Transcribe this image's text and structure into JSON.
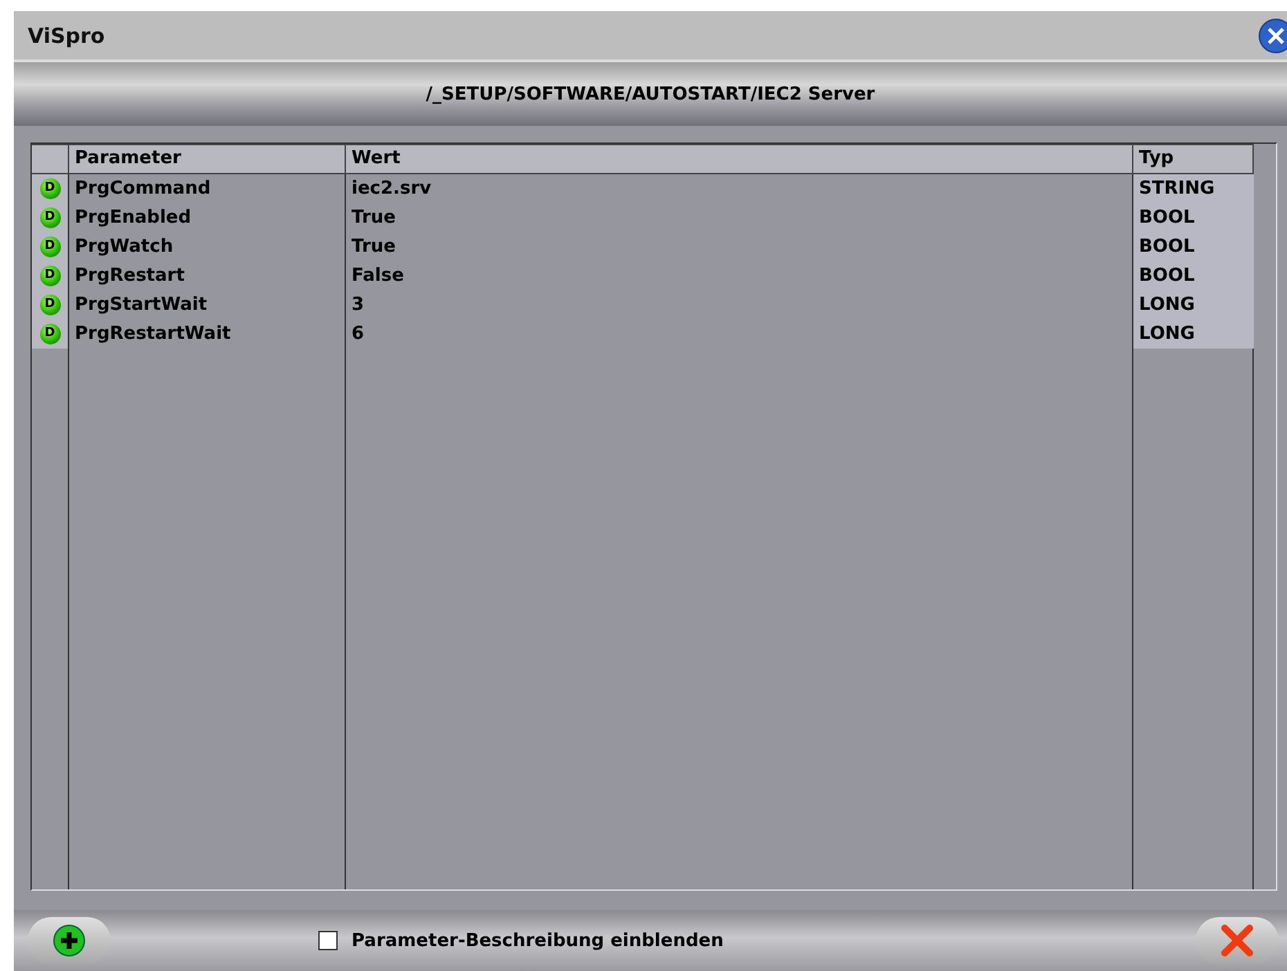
{
  "window": {
    "title": "ViSpro"
  },
  "path": "/_SETUP/SOFTWARE/AUTOSTART/IEC2 Server",
  "table": {
    "columns": [
      "Parameter",
      "Wert",
      "Typ"
    ],
    "rows": [
      {
        "badge": "D",
        "parameter": "PrgCommand",
        "value": "iec2.srv",
        "type": "STRING"
      },
      {
        "badge": "D",
        "parameter": "PrgEnabled",
        "value": "True",
        "type": "BOOL"
      },
      {
        "badge": "D",
        "parameter": "PrgWatch",
        "value": "True",
        "type": "BOOL"
      },
      {
        "badge": "D",
        "parameter": "PrgRestart",
        "value": "False",
        "type": "BOOL"
      },
      {
        "badge": "D",
        "parameter": "PrgStartWait",
        "value": "3",
        "type": "LONG"
      },
      {
        "badge": "D",
        "parameter": "PrgRestartWait",
        "value": "6",
        "type": "LONG"
      }
    ]
  },
  "description_toggle": {
    "label": "Parameter-Beschreibung einblenden",
    "checked": false
  }
}
